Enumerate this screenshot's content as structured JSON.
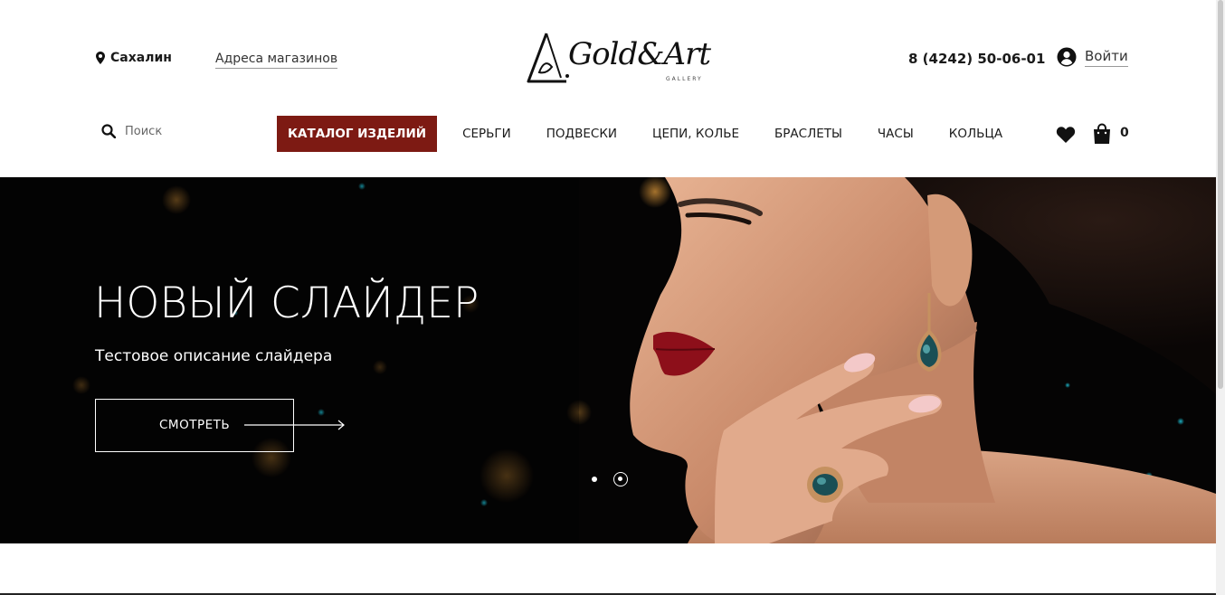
{
  "header": {
    "city": "Сахалин",
    "stores_link": "Адреса магазинов",
    "logo_text": "Gold&Art",
    "logo_sub": "GALLERY",
    "phone": "8 (4242) 50-06-01",
    "login_label": "Войти"
  },
  "search": {
    "placeholder": "Поиск"
  },
  "nav": {
    "items": [
      {
        "label": "КАТАЛОГ ИЗДЕЛИЙ"
      },
      {
        "label": "СЕРЬГИ"
      },
      {
        "label": "ПОДВЕСКИ"
      },
      {
        "label": "ЦЕПИ, КОЛЬЕ"
      },
      {
        "label": "БРАСЛЕТЫ"
      },
      {
        "label": "ЧАСЫ"
      },
      {
        "label": "КОЛЬЦА"
      }
    ]
  },
  "icons": {
    "location": "map-pin-icon",
    "user": "user-circle-icon",
    "search": "search-icon",
    "favorites": "heart-icon",
    "cart": "shopping-bag-icon",
    "arrow": "long-arrow-right-icon"
  },
  "cart": {
    "count": "0"
  },
  "slider": {
    "title": "НОВЫЙ СЛАЙДЕР",
    "description": "Тестовое описание слайдера",
    "button_label": "СМОТРЕТЬ",
    "slides_total": 2,
    "active_slide": 2
  },
  "colors": {
    "accent": "#7d1a13",
    "hero_bg": "#050404",
    "text": "#1a1a1a"
  }
}
